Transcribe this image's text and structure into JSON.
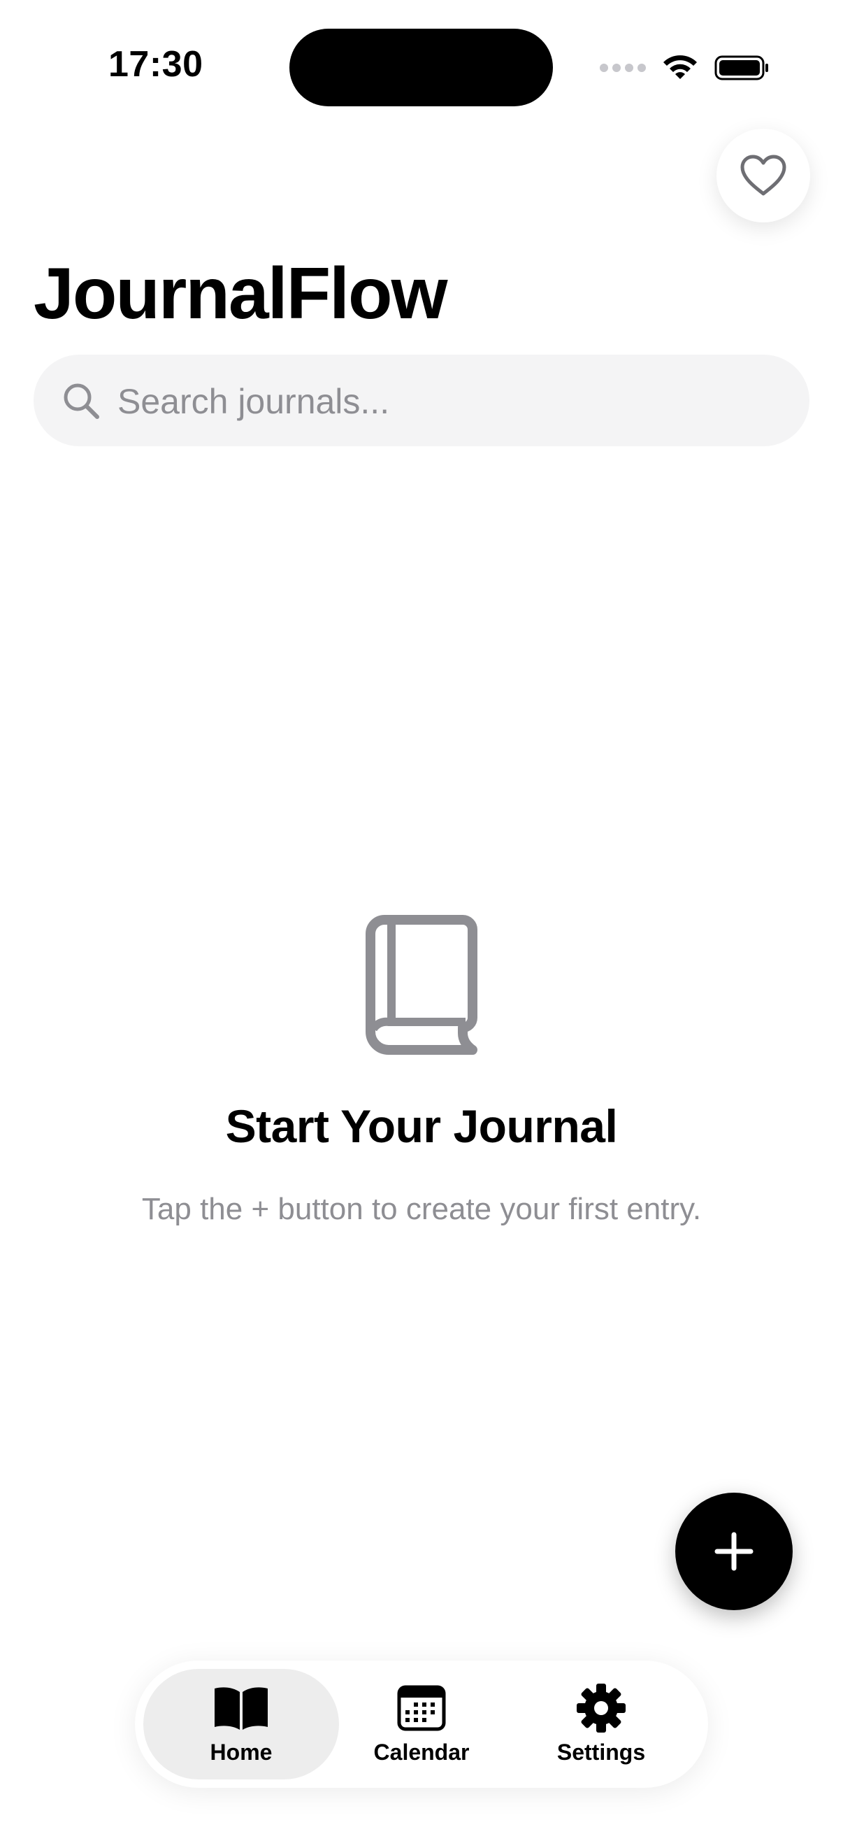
{
  "status_bar": {
    "time": "17:30"
  },
  "header": {
    "title": "JournalFlow",
    "favorite_icon": "heart-outline-icon"
  },
  "search": {
    "placeholder": "Search journals...",
    "value": "",
    "icon": "magnifying-glass-icon"
  },
  "empty_state": {
    "icon": "book-icon",
    "title": "Start Your Journal",
    "subtitle": "Tap the + button to create your first entry."
  },
  "fab": {
    "icon": "plus-icon"
  },
  "tab_bar": {
    "items": [
      {
        "label": "Home",
        "icon": "book-open-icon",
        "active": true
      },
      {
        "label": "Calendar",
        "icon": "calendar-icon",
        "active": false
      },
      {
        "label": "Settings",
        "icon": "gear-icon",
        "active": false
      }
    ]
  },
  "colors": {
    "accent": "#000000",
    "secondary_text": "#8e8e93",
    "search_bg": "#f4f4f5",
    "active_tab_bg": "#ededed",
    "icon_gray": "#8e8e93"
  }
}
